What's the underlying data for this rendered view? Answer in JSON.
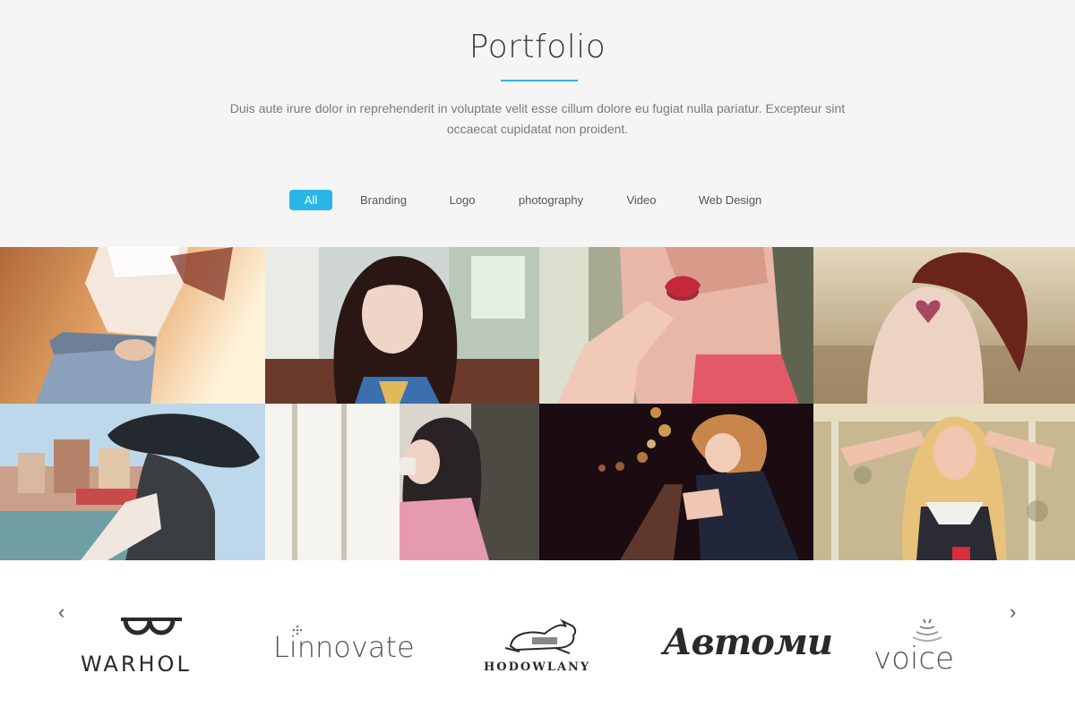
{
  "section": {
    "title": "Portfolio",
    "description": "Duis aute irure dolor in reprehenderit in voluptate velit esse cillum dolore eu fugiat nulla pariatur. Excepteur sint occaecat cupidatat non proident."
  },
  "filters": [
    {
      "label": "All",
      "active": true
    },
    {
      "label": "Branding",
      "active": false
    },
    {
      "label": "Logo",
      "active": false
    },
    {
      "label": "photography",
      "active": false
    },
    {
      "label": "Video",
      "active": false
    },
    {
      "label": "Web Design",
      "active": false
    }
  ],
  "colors": {
    "accent": "#29b6e6",
    "hero_background": "#f5f5f5"
  },
  "portfolio": {
    "items": [
      {
        "icon": "photo-woman-jeans-sunset"
      },
      {
        "icon": "photo-woman-portrait-dark-hair"
      },
      {
        "icon": "photo-woman-eating-strawberry"
      },
      {
        "icon": "photo-woman-back-tattoo-field"
      },
      {
        "icon": "photo-woman-hat-venice"
      },
      {
        "icon": "photo-woman-window-cup"
      },
      {
        "icon": "photo-woman-night-lights"
      },
      {
        "icon": "photo-woman-blonde-wallpaper"
      }
    ]
  },
  "clients": {
    "prev_icon": "chevron-left-icon",
    "next_icon": "chevron-right-icon",
    "logos": [
      {
        "name": "WARHOL"
      },
      {
        "name": "Linnovate"
      },
      {
        "name": "HODOWLANY"
      },
      {
        "name": "Автомu"
      },
      {
        "name": "voice"
      }
    ]
  }
}
